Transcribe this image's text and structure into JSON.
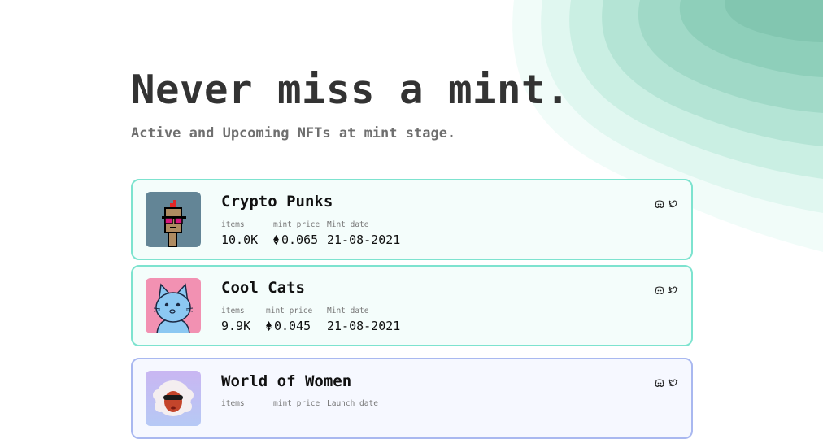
{
  "hero": {
    "title": "Never miss a mint.",
    "subtitle": "Active and Upcoming NFTs at mint stage."
  },
  "theme": {
    "title_color": "#333333",
    "subtitle_color": "#6f6f6f",
    "card_border_teal": "#7de3cf",
    "card_border_purple": "#a9b8f0",
    "wave_colors": [
      "#eefcf8",
      "#dcf6ee",
      "#c6ede1",
      "#b1e3d3",
      "#9dd8c5",
      "#8bcdb8"
    ]
  },
  "projects": [
    {
      "name": "Crypto Punks",
      "items_label": "items",
      "items": "10.0K",
      "price_label": "mint price",
      "price": "0.065",
      "currency_icon": "ethereum-icon",
      "date_label": "Mint date",
      "date": "21-08-2021",
      "socials": [
        "discord-icon",
        "twitter-icon"
      ]
    },
    {
      "name": "Cool Cats",
      "items_label": "items",
      "items": "9.9K",
      "price_label": "mint price",
      "price": "0.045",
      "currency_icon": "ethereum-icon",
      "date_label": "Mint date",
      "date": "21-08-2021",
      "socials": [
        "discord-icon",
        "twitter-icon"
      ]
    },
    {
      "name": "World of Women",
      "items_label": "items",
      "price_label": "mint price",
      "date_label": "Launch date",
      "socials": [
        "discord-icon",
        "twitter-icon"
      ]
    }
  ]
}
